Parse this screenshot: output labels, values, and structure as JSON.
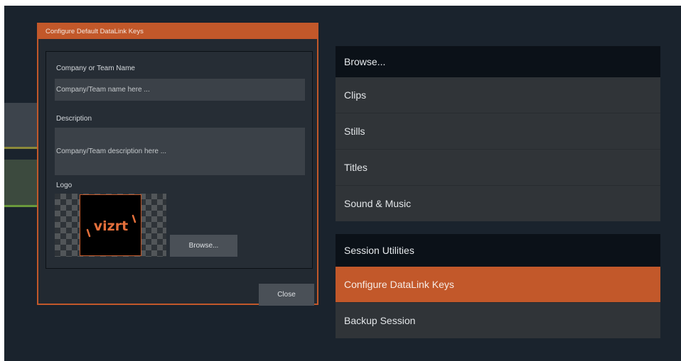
{
  "dialog": {
    "title": "Configure Default DataLink Keys",
    "company_label": "Company or Team Name",
    "company_placeholder": "Company/Team name here ...",
    "description_label": "Description",
    "description_placeholder": "Company/Team description here ...",
    "logo_label": "Logo",
    "logo_text": "vizrt",
    "browse_label": "Browse...",
    "close_label": "Close"
  },
  "browse_menu": {
    "header": "Browse...",
    "items": [
      "Clips",
      "Stills",
      "Titles",
      "Sound & Music"
    ]
  },
  "session_menu": {
    "header": "Session Utilities",
    "items": [
      "Configure DataLink Keys",
      "Backup Session"
    ],
    "active_index": 0
  },
  "colors": {
    "accent": "#c2582a",
    "background": "#1a232d",
    "menu_item": "#303438",
    "menu_header": "#0b1118"
  }
}
